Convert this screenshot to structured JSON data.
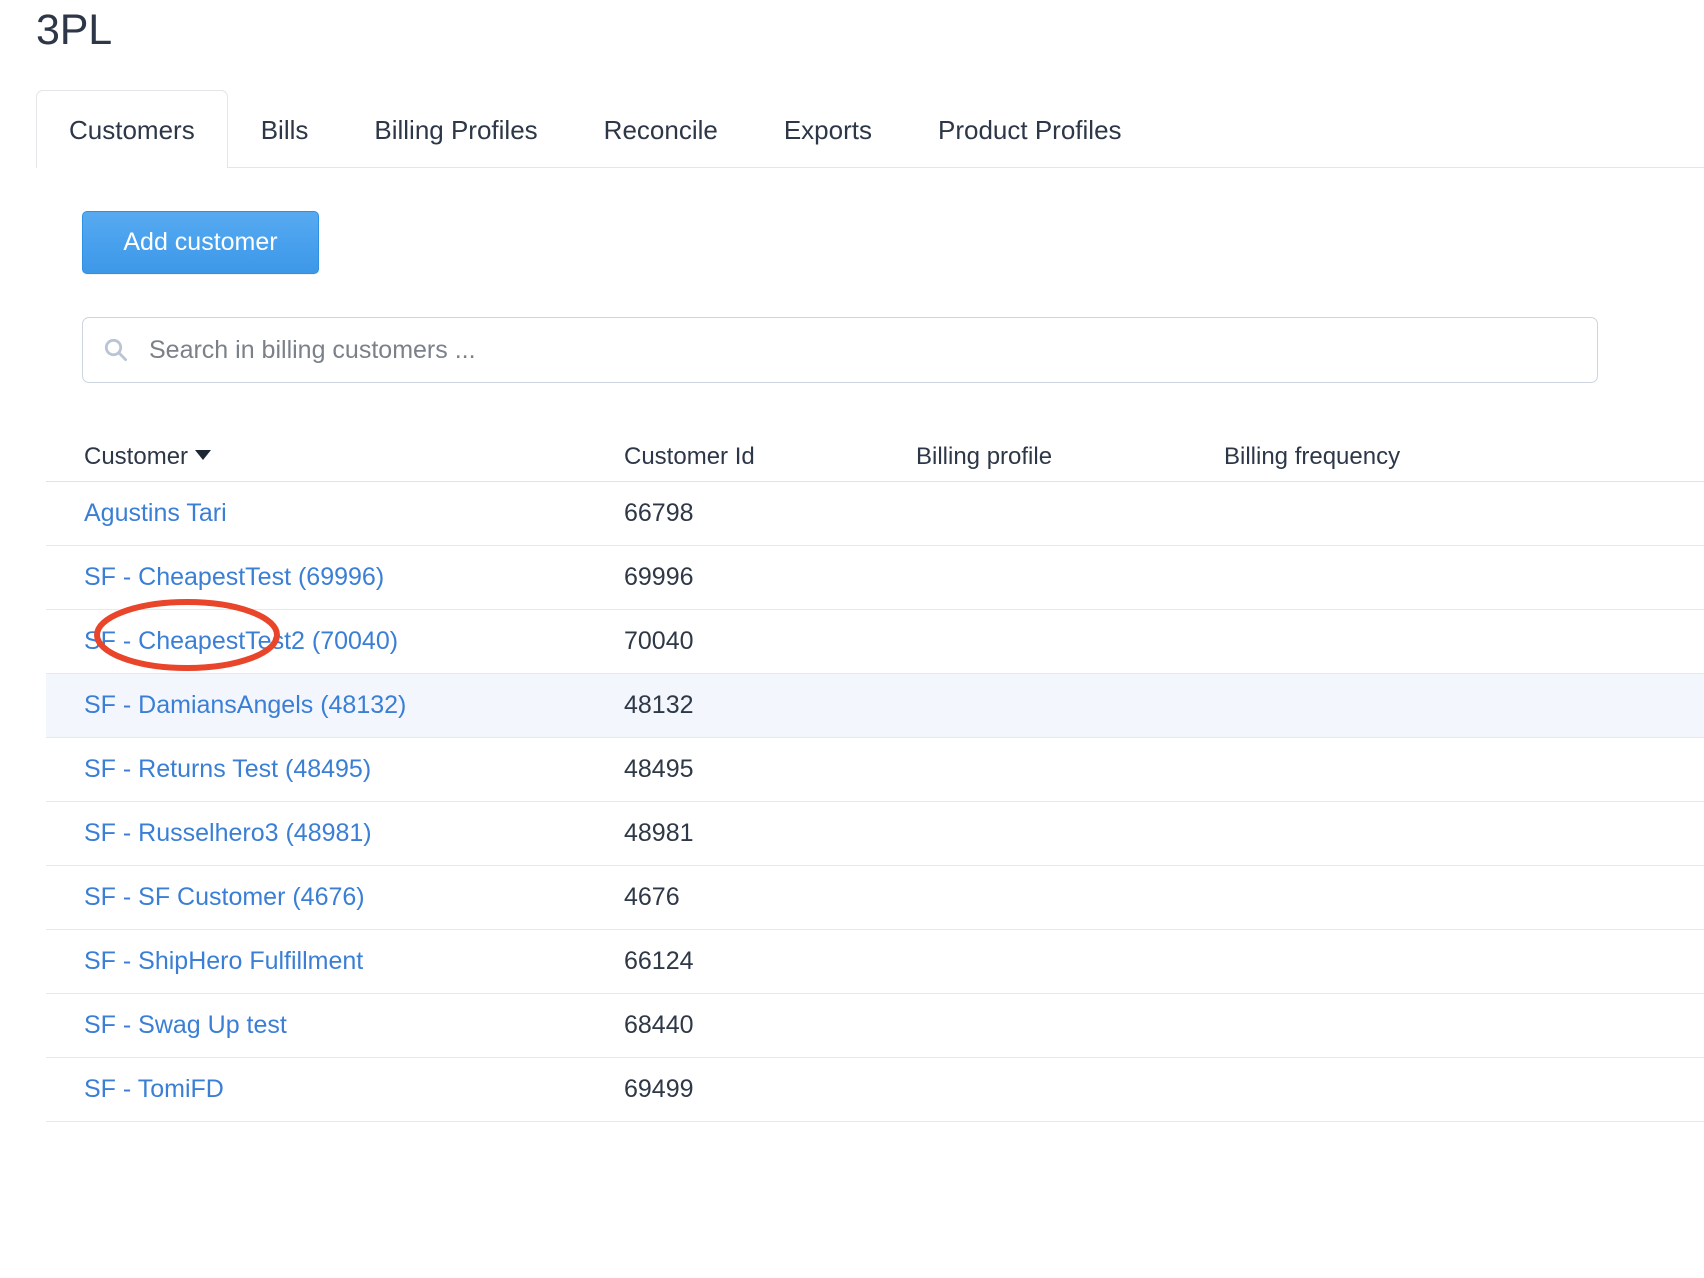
{
  "header": {
    "title": "3PL"
  },
  "tabs": [
    {
      "label": "Customers",
      "active": true
    },
    {
      "label": "Bills",
      "active": false
    },
    {
      "label": "Billing Profiles",
      "active": false
    },
    {
      "label": "Reconcile",
      "active": false
    },
    {
      "label": "Exports",
      "active": false
    },
    {
      "label": "Product Profiles",
      "active": false
    }
  ],
  "toolbar": {
    "add_customer_label": "Add customer"
  },
  "search": {
    "placeholder": "Search in billing customers ...",
    "value": "",
    "icon": "search-icon"
  },
  "table": {
    "columns": [
      {
        "label": "Customer",
        "sorted": true,
        "sort_icon": "caret-down-icon"
      },
      {
        "label": "Customer Id",
        "sorted": false
      },
      {
        "label": "Billing profile",
        "sorted": false
      },
      {
        "label": "Billing frequency",
        "sorted": false
      }
    ],
    "rows": [
      {
        "customer": "Agustins Tari",
        "customer_id": "66798",
        "billing_profile": "",
        "billing_frequency": "",
        "highlighted": false
      },
      {
        "customer": "SF - CheapestTest (69996)",
        "customer_id": "69996",
        "billing_profile": "",
        "billing_frequency": "",
        "highlighted": false
      },
      {
        "customer": "SF - CheapestTest2 (70040)",
        "customer_id": "70040",
        "billing_profile": "",
        "billing_frequency": "",
        "highlighted": false
      },
      {
        "customer": "SF - DamiansAngels (48132)",
        "customer_id": "48132",
        "billing_profile": "",
        "billing_frequency": "",
        "highlighted": true
      },
      {
        "customer": "SF - Returns Test (48495)",
        "customer_id": "48495",
        "billing_profile": "",
        "billing_frequency": "",
        "highlighted": false
      },
      {
        "customer": "SF - Russelhero3 (48981)",
        "customer_id": "48981",
        "billing_profile": "",
        "billing_frequency": "",
        "highlighted": false
      },
      {
        "customer": "SF - SF Customer (4676)",
        "customer_id": "4676",
        "billing_profile": "",
        "billing_frequency": "",
        "highlighted": false
      },
      {
        "customer": "SF - ShipHero Fulfillment",
        "customer_id": "66124",
        "billing_profile": "",
        "billing_frequency": "",
        "highlighted": false
      },
      {
        "customer": "SF - Swag Up test",
        "customer_id": "68440",
        "billing_profile": "",
        "billing_frequency": "",
        "highlighted": false
      },
      {
        "customer": "SF - TomiFD",
        "customer_id": "69499",
        "billing_profile": "",
        "billing_frequency": "",
        "highlighted": false
      }
    ]
  },
  "annotation": {
    "shape": "ellipse",
    "target": "Customer",
    "color": "#e8452a"
  },
  "colors": {
    "accent_blue": "#4aa2ee",
    "link_blue": "#3a7fd5",
    "text_dark": "#2d3747",
    "row_highlight": "#f3f7fd",
    "border": "#e3e5e8",
    "annotation_red": "#e8452a"
  }
}
